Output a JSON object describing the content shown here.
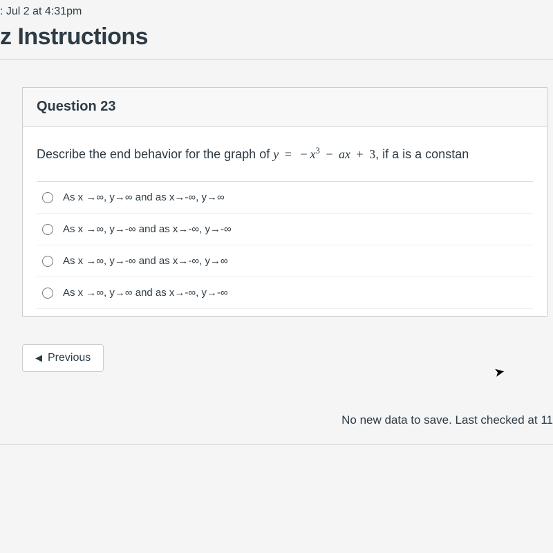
{
  "header": {
    "due_line": ": Jul 2 at 4:31pm",
    "page_title": "z Instructions"
  },
  "question": {
    "title": "Question 23",
    "prompt_prefix": "Describe the end behavior for the graph of ",
    "prompt_equation_y": "y",
    "prompt_eq": " = ",
    "prompt_neg": "−",
    "prompt_x": "x",
    "prompt_exp": "3",
    "prompt_minus": " − ",
    "prompt_ax": "ax",
    "prompt_plus": " + ",
    "prompt_const": "3",
    "prompt_suffix": ", if a is a constan"
  },
  "answers": [
    "As x →∞, y→∞ and as x→-∞, y→∞",
    "As x →∞, y→-∞ and as x→-∞, y→-∞",
    "As x →∞, y→-∞ and as x→-∞, y→∞",
    "As x →∞, y→∞ and as x→-∞, y→-∞"
  ],
  "nav": {
    "previous_label": "Previous"
  },
  "status": {
    "save_text": "No new data to save. Last checked at 11"
  }
}
